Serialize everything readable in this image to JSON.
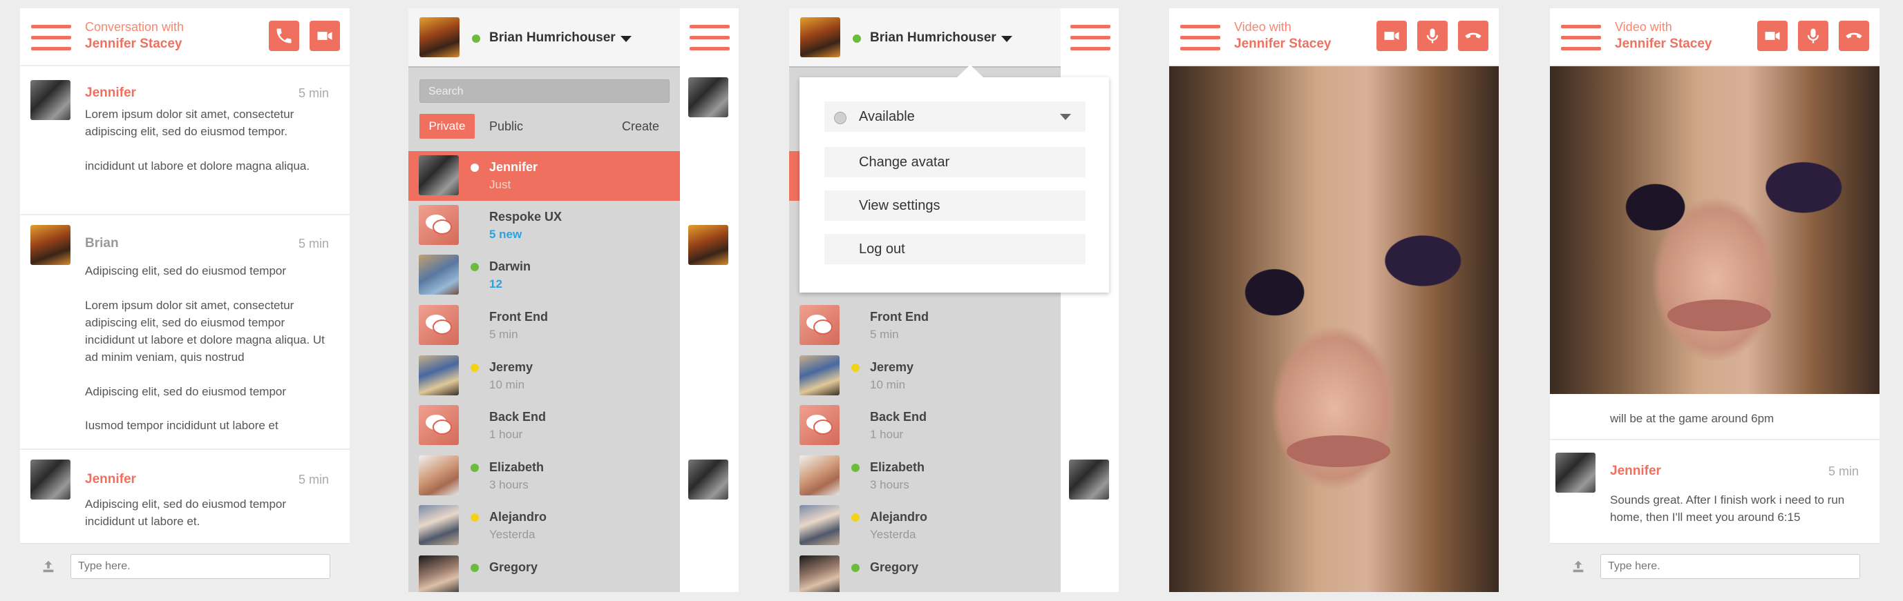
{
  "panel1": {
    "header_subtitle": "Conversation with",
    "header_title": "Jennifer Stacey",
    "messages": [
      {
        "name": "Jennifer",
        "time": "5 min",
        "paragraphs": [
          "Lorem ipsum dolor sit amet, consectetur adipiscing elit, sed do eiusmod tempor.",
          "incididunt ut labore et dolore magna aliqua."
        ]
      },
      {
        "name": "Brian",
        "time": "5 min",
        "paragraphs": [
          "Adipiscing elit, sed do eiusmod tempor",
          "Lorem ipsum dolor sit amet, consectetur adipiscing elit, sed do eiusmod tempor incididunt ut labore et dolore magna aliqua. Ut ad minim veniam, quis nostrud",
          "Adipiscing elit, sed do eiusmod tempor",
          "Iusmod tempor incididunt ut labore et"
        ]
      },
      {
        "name": "Jennifer",
        "time": "5 min",
        "paragraphs": [
          "Adipiscing elit, sed do eiusmod tempor incididunt ut labore et."
        ]
      }
    ],
    "input_placeholder": "Type here."
  },
  "user": {
    "name": "Brian Humrichouser",
    "status": "online"
  },
  "panel2": {
    "search_placeholder": "Search",
    "tabs": {
      "private": "Private",
      "public": "Public",
      "create": "Create"
    },
    "contacts": [
      {
        "name": "Jennifer",
        "sub": "Just",
        "status": "white",
        "avatar": "woman"
      },
      {
        "name": "Respoke UX",
        "sub": "5 new",
        "status": "none",
        "avatar": "chat"
      },
      {
        "name": "Darwin",
        "sub": "12",
        "status": "green",
        "avatar": "darwin"
      },
      {
        "name": "Front End",
        "sub": "5 min",
        "status": "none",
        "avatar": "chat"
      },
      {
        "name": "Jeremy",
        "sub": "10 min",
        "status": "yellow",
        "avatar": "jeremy"
      },
      {
        "name": "Back End",
        "sub": "1 hour",
        "status": "none",
        "avatar": "chat"
      },
      {
        "name": "Elizabeth",
        "sub": "3 hours",
        "status": "green",
        "avatar": "elizabeth"
      },
      {
        "name": "Alejandro",
        "sub": "Yesterda",
        "status": "yellow",
        "avatar": "alejandro"
      },
      {
        "name": "Gregory",
        "sub": "",
        "status": "green",
        "avatar": "gregory"
      }
    ]
  },
  "panel3": {
    "menu": {
      "status_label": "Available",
      "change_avatar": "Change avatar",
      "view_settings": "View settings",
      "log_out": "Log out"
    }
  },
  "panel4": {
    "header_subtitle": "Video with",
    "header_title": "Jennifer Stacey"
  },
  "panel5": {
    "header_subtitle": "Video with",
    "header_title": "Jennifer Stacey",
    "previous_text": "will be at the game around 6pm",
    "message": {
      "name": "Jennifer",
      "time": "5 min",
      "text": "Sounds great. After I finish work i need to run home, then I'll meet you around 6:15"
    },
    "input_placeholder": "Type here."
  },
  "colors": {
    "accent": "#f07060",
    "online": "#6cbb3c",
    "away": "#f2d31a",
    "new_count": "#29a3e0"
  }
}
